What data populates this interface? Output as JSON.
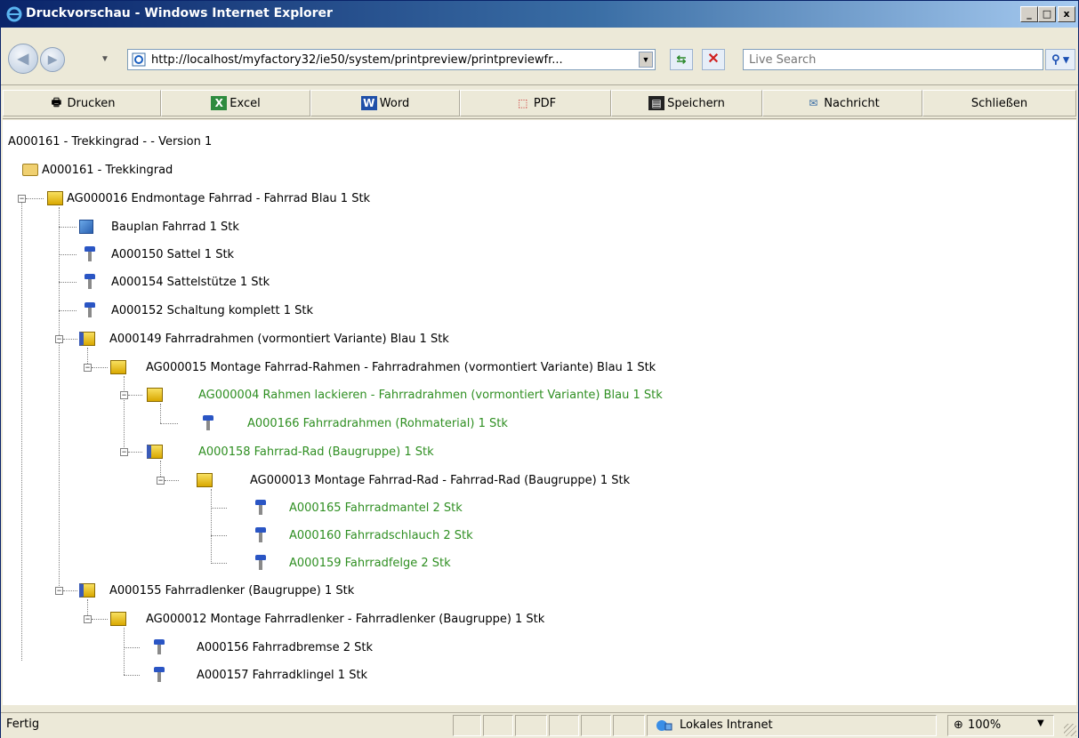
{
  "window": {
    "title": "Druckvorschau - Windows Internet Explorer"
  },
  "caption_buttons": {
    "minimize": "_",
    "maximize": "□",
    "close": "x"
  },
  "address": {
    "url": "http://localhost/myfactory32/ie50/system/printpreview/printpreviewfr..."
  },
  "search": {
    "placeholder": "Live Search"
  },
  "toolbar": {
    "print": "Drucken",
    "excel": "Excel",
    "word": "Word",
    "pdf": "PDF",
    "save": "Speichern",
    "message": "Nachricht",
    "close": "Schließen"
  },
  "doc": {
    "header": "A000161 - Trekkingrad - - Version 1",
    "root": "A000161 - Trekkingrad",
    "items": [
      "AG000016 Endmontage Fahrrad - Fahrrad Blau 1 Stk",
      "Bauplan Fahrrad 1 Stk",
      "A000150 Sattel 1 Stk",
      "A000154 Sattelstütze 1 Stk",
      "A000152 Schaltung komplett 1 Stk",
      "A000149 Fahrradrahmen (vormontiert Variante) Blau 1 Stk",
      "AG000015 Montage Fahrrad-Rahmen - Fahrradrahmen (vormontiert Variante) Blau 1 Stk",
      "AG000004 Rahmen lackieren - Fahrradrahmen (vormontiert Variante) Blau 1 Stk",
      "A000166 Fahrradrahmen (Rohmaterial) 1 Stk",
      "A000158 Fahrrad-Rad (Baugruppe) 1 Stk",
      "AG000013 Montage Fahrrad-Rad - Fahrrad-Rad (Baugruppe) 1 Stk",
      "A000165 Fahrradmantel 2 Stk",
      "A000160 Fahrradschlauch 2 Stk",
      "A000159 Fahrradfelge 2 Stk",
      "A000155 Fahrradlenker (Baugruppe) 1 Stk",
      "AG000012 Montage Fahrradlenker - Fahrradlenker (Baugruppe) 1 Stk",
      "A000156 Fahrradbremse 2 Stk",
      "A000157 Fahrradklingel 1 Stk"
    ]
  },
  "status": {
    "text": "Fertig",
    "zone": "Lokales Intranet",
    "zoom": "100%"
  },
  "colors": {
    "green_text": "#2f8f22",
    "title_bar": "#0a246a"
  }
}
